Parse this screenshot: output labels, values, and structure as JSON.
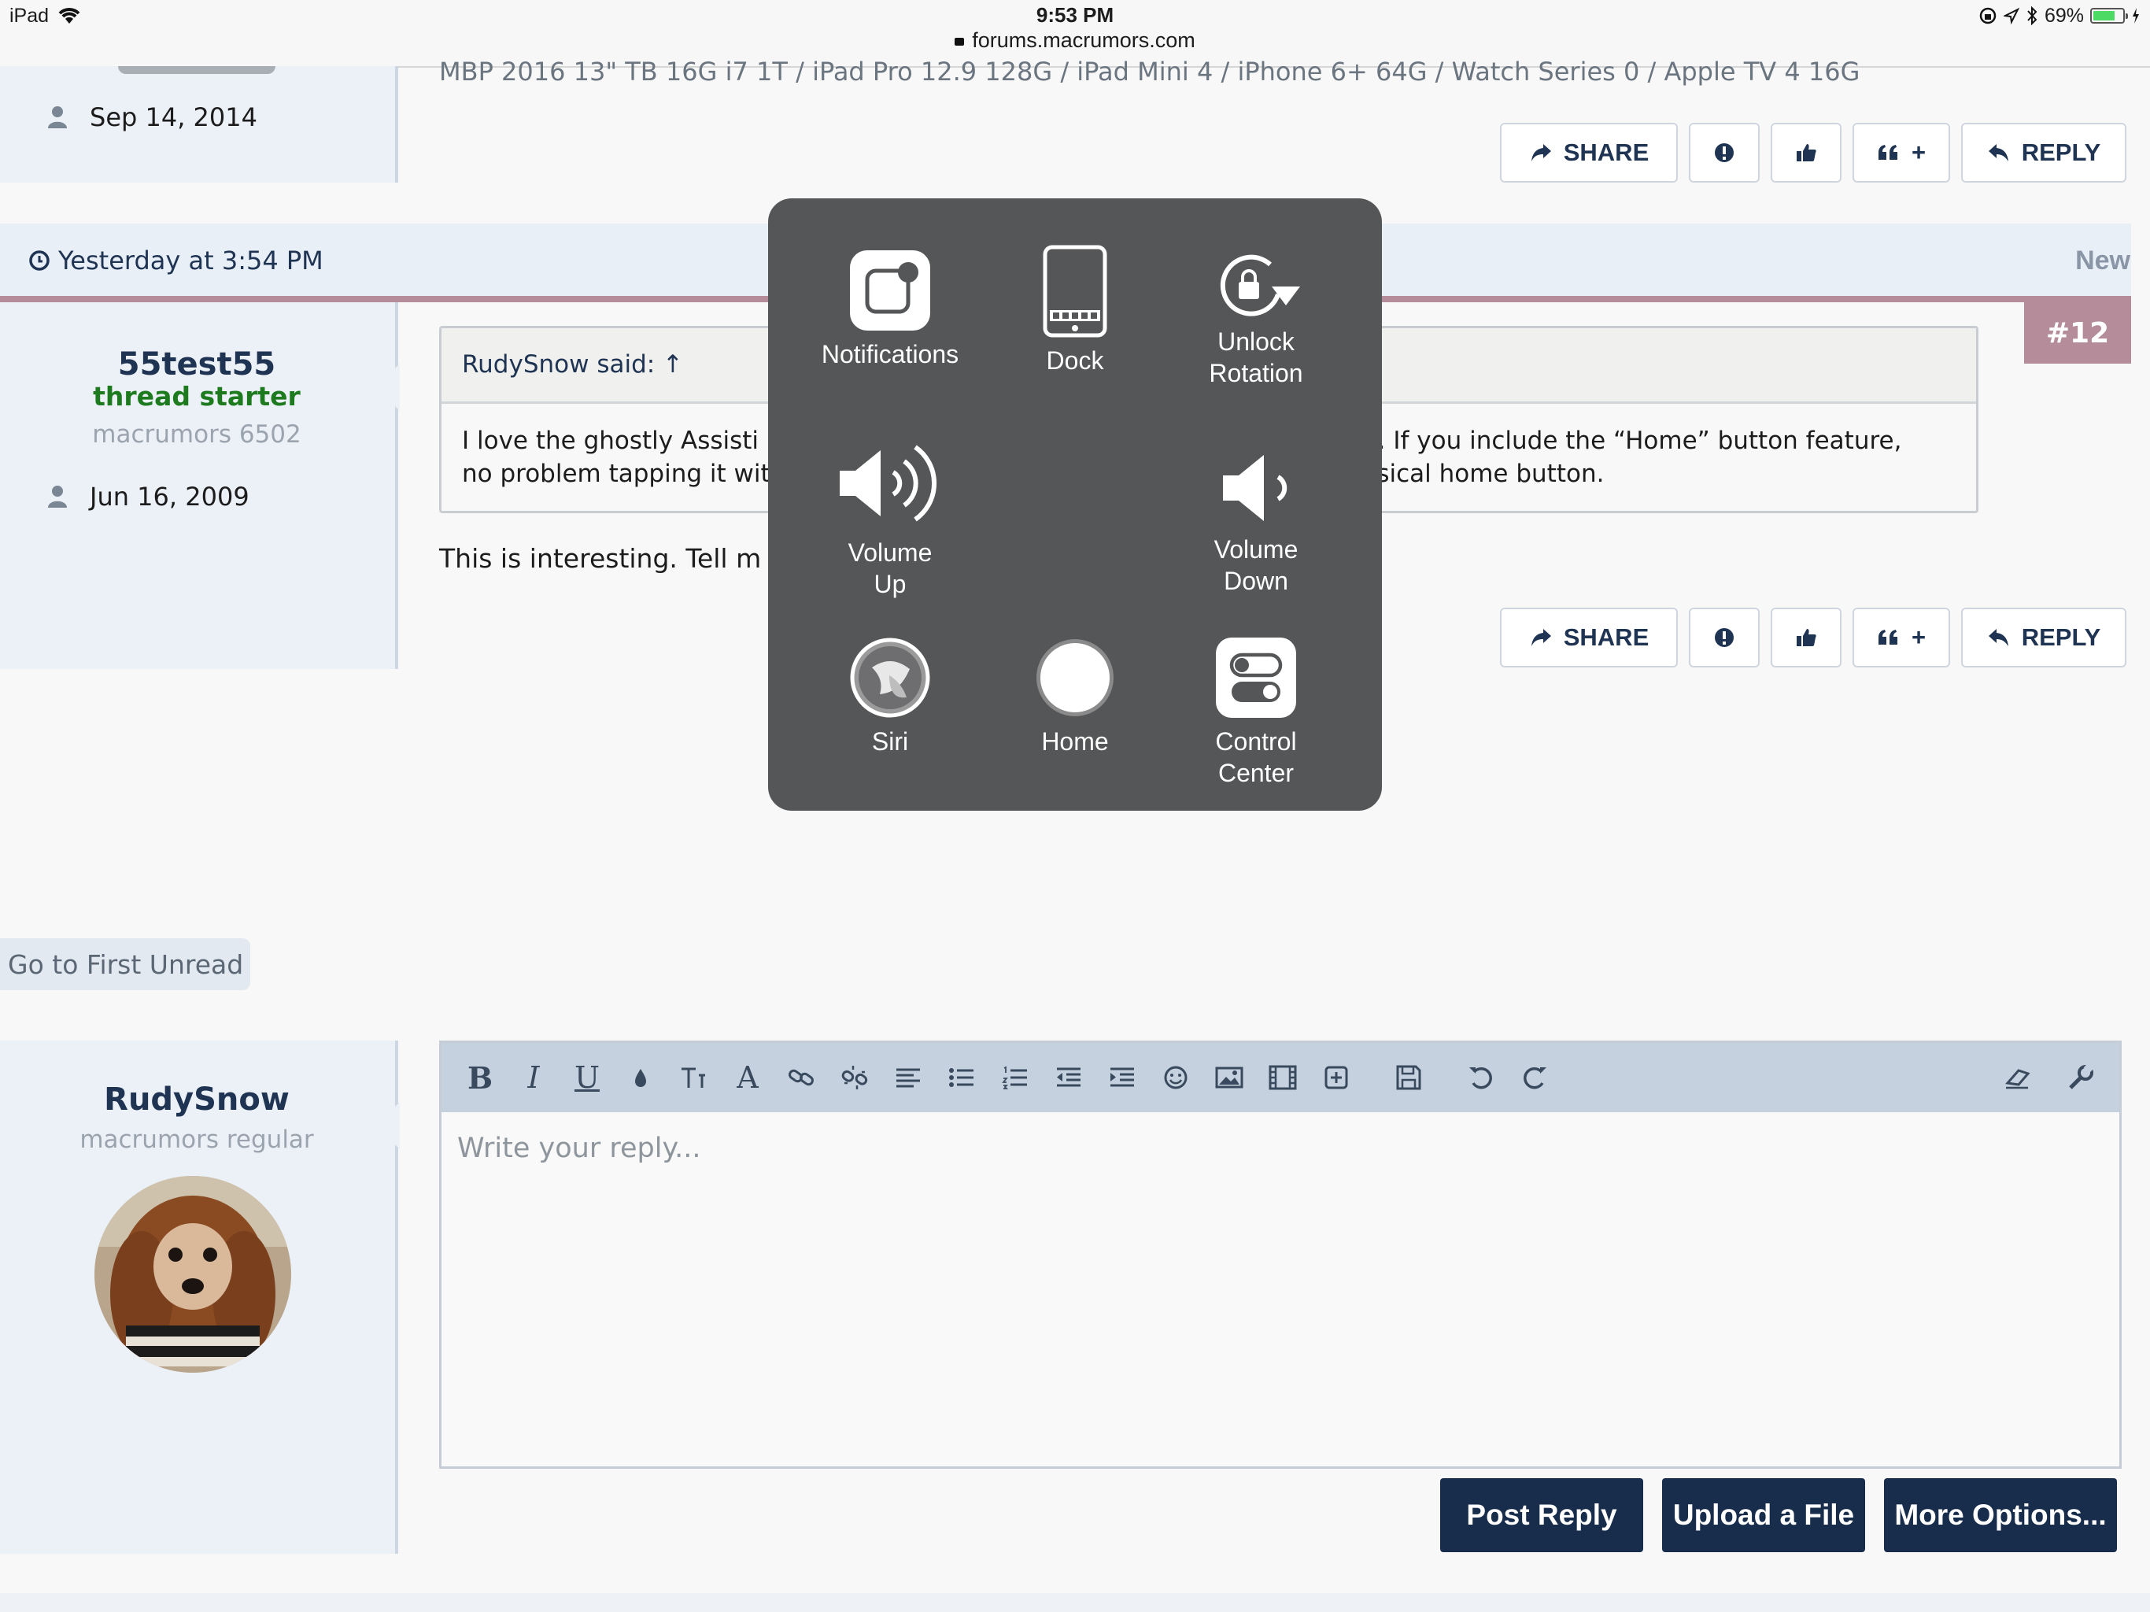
{
  "status_bar": {
    "device": "iPad",
    "time": "9:53 PM",
    "url": "forums.macrumors.com",
    "battery": "69%",
    "battery_level": 0.69
  },
  "prev_post": {
    "joined": "Sep 14, 2014",
    "signature": "MBP 2016 13\" TB 16G i7 1T / iPad Pro 12.9 128G / iPad Mini 4 / iPhone 6+ 64G / Watch Series 0 / Apple TV 4 16G",
    "actions": {
      "share": "SHARE",
      "quote": "+",
      "reply": "REPLY"
    }
  },
  "post12": {
    "date": "Yesterday at 3:54 PM",
    "new_label": "New",
    "number": "#12",
    "username": "55test55",
    "user_title": "thread starter",
    "user_rank": "macrumors 6502",
    "joined": "Jun 16, 2009",
    "quote_author": "RudySnow said: ↑",
    "quote_line1_left": "I love the ghostly Assisti",
    "quote_line1_right": "d. If you include the “Home” button feature,",
    "quote_line2_left": "no problem tapping it wit",
    "quote_line2_right": "ysical home button.",
    "body_text": "This is interesting. Tell m",
    "actions": {
      "share": "SHARE",
      "quote": "+",
      "reply": "REPLY"
    }
  },
  "first_unread": "Go to First Unread",
  "reply_user": {
    "username": "RudySnow",
    "user_rank": "macrumors regular"
  },
  "editor": {
    "placeholder": "Write your reply...",
    "bold": "B",
    "italic": "I",
    "underline": "U",
    "font": "A"
  },
  "buttons": {
    "post_reply": "Post Reply",
    "upload": "Upload a File",
    "more": "More Options..."
  },
  "assistive_touch": {
    "notifications": "Notifications",
    "dock": "Dock",
    "unlock_line1": "Unlock",
    "unlock_line2": "Rotation",
    "volume_up_line1": "Volume",
    "volume_up_line2": "Up",
    "volume_down_line1": "Volume",
    "volume_down_line2": "Down",
    "siri": "Siri",
    "home": "Home",
    "control_line1": "Control",
    "control_line2": "Center"
  },
  "colors": {
    "accent_navy": "#182c4c",
    "post_divider": "#b48c9a",
    "post_number_bg": "#b48c9a",
    "thread_starter": "#1e7a1e"
  }
}
